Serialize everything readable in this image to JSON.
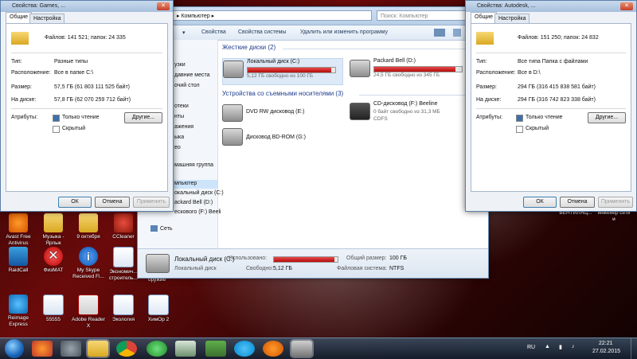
{
  "desktop": {
    "icons": [
      {
        "label": "Avast Free Antivirus"
      },
      {
        "label": "Музыка - Ярлык"
      },
      {
        "label": "9 октября"
      },
      {
        "label": "CCleaner"
      },
      {
        "label": "RaidCall"
      },
      {
        "label": "ФизМАТ"
      },
      {
        "label": "My Skype Received Fi..."
      },
      {
        "label": "Экономич... строитель..."
      },
      {
        "label": "Reimage Express"
      },
      {
        "label": "55555"
      },
      {
        "label": "Adobe Reader X"
      },
      {
        "label": "Экология"
      },
      {
        "label": "ХимОр 2"
      },
      {
        "label": "ВЕНТИЛЯЦ..."
      },
      {
        "label": "инженер сети и"
      }
    ],
    "overlap_label": "оружие"
  },
  "explorer": {
    "address": "▸ Компьютер ▸",
    "search_placeholder": "Поиск: Компьютер",
    "toolbar": {
      "organize": "▾",
      "properties": "Свойства",
      "system_properties": "Свойства системы",
      "uninstall": "Удалить или изменить программу"
    },
    "nav": {
      "items": [
        "узки",
        "давние места",
        "очий стол",
        "отеки",
        "нты",
        "ажения",
        "ыка",
        "ео",
        "машняя группа",
        "мпьютер",
        "окальный диск (C:)",
        "ackard Bell (D:)",
        "ескового (F:) Beeli",
        "Сеть"
      ]
    },
    "hard_disks": {
      "header": "Жесткие диски (2)",
      "drives": [
        {
          "name": "Локальный диск (C:)",
          "free": "5,12 ГБ свободно из 100 ГБ",
          "used_fraction": 0.95
        },
        {
          "name": "Packard Bell (D:)",
          "free": "24,5 ГБ свободно из 345 ГБ",
          "used_fraction": 0.93
        }
      ]
    },
    "removable": {
      "header": "Устройства со съемными носителями (3)",
      "devices": [
        {
          "name": "DVD RW дисковод (E:)"
        },
        {
          "name": "CD-дисковод (F:) Beeline",
          "free": "0 байт свободно из 31,3 МБ",
          "fs": "CDFS"
        },
        {
          "name": "Дисковод BD-ROM (G:)"
        }
      ]
    },
    "details": {
      "name": "Локальный диск (C:)",
      "type": "Локальный диск",
      "used_label": "Использовано:",
      "free_label": "Свободно:",
      "free_value": "5,12 ГБ",
      "total_label": "Общий размер:",
      "total_value": "100 ГБ",
      "fs_label": "Файловая система:",
      "fs_value": "NTFS",
      "used_fraction": 0.95
    }
  },
  "dialog_left": {
    "title": "Свойства: Games, ...",
    "tabs": [
      "Общие",
      "Настройка"
    ],
    "summary": "Файлов: 141 521; папок: 24 335",
    "type_label": "Тип:",
    "type_value": "Разные типы",
    "location_label": "Расположение:",
    "location_value": "Все в папке C:\\",
    "size_label": "Размер:",
    "size_value": "57,5 ГБ (61 803 111 525 байт)",
    "disk_label": "На диске:",
    "disk_value": "57,8 ГБ (62 070 259 712 байт)",
    "attr_label": "Атрибуты:",
    "readonly": "Только чтение",
    "hidden": "Скрытый",
    "other_btn": "Другие...",
    "ok": "ОК",
    "cancel": "Отмена",
    "apply": "Применить"
  },
  "dialog_right": {
    "title": "Свойства: Autodesk, ...",
    "tabs": [
      "Общие",
      "Настройка"
    ],
    "summary": "Файлов: 151 250; папок: 24 832",
    "type_label": "Тип:",
    "type_value": "Все типа Папка с файлами",
    "location_label": "Расположение:",
    "location_value": "Все в D:\\",
    "size_label": "Размер:",
    "size_value": "294 ГБ (316 415 838 581 байт)",
    "disk_label": "На диске:",
    "disk_value": "294 ГБ (316 742 823 338 байт)",
    "attr_label": "Атрибуты:",
    "readonly": "Только чтение",
    "hidden": "Скрытый",
    "other_btn": "Другие...",
    "ok": "ОК",
    "cancel": "Отмена",
    "apply": "Применить"
  },
  "taskbar": {
    "lang": "RU",
    "time": "22:21",
    "date": "27.02.2015"
  }
}
